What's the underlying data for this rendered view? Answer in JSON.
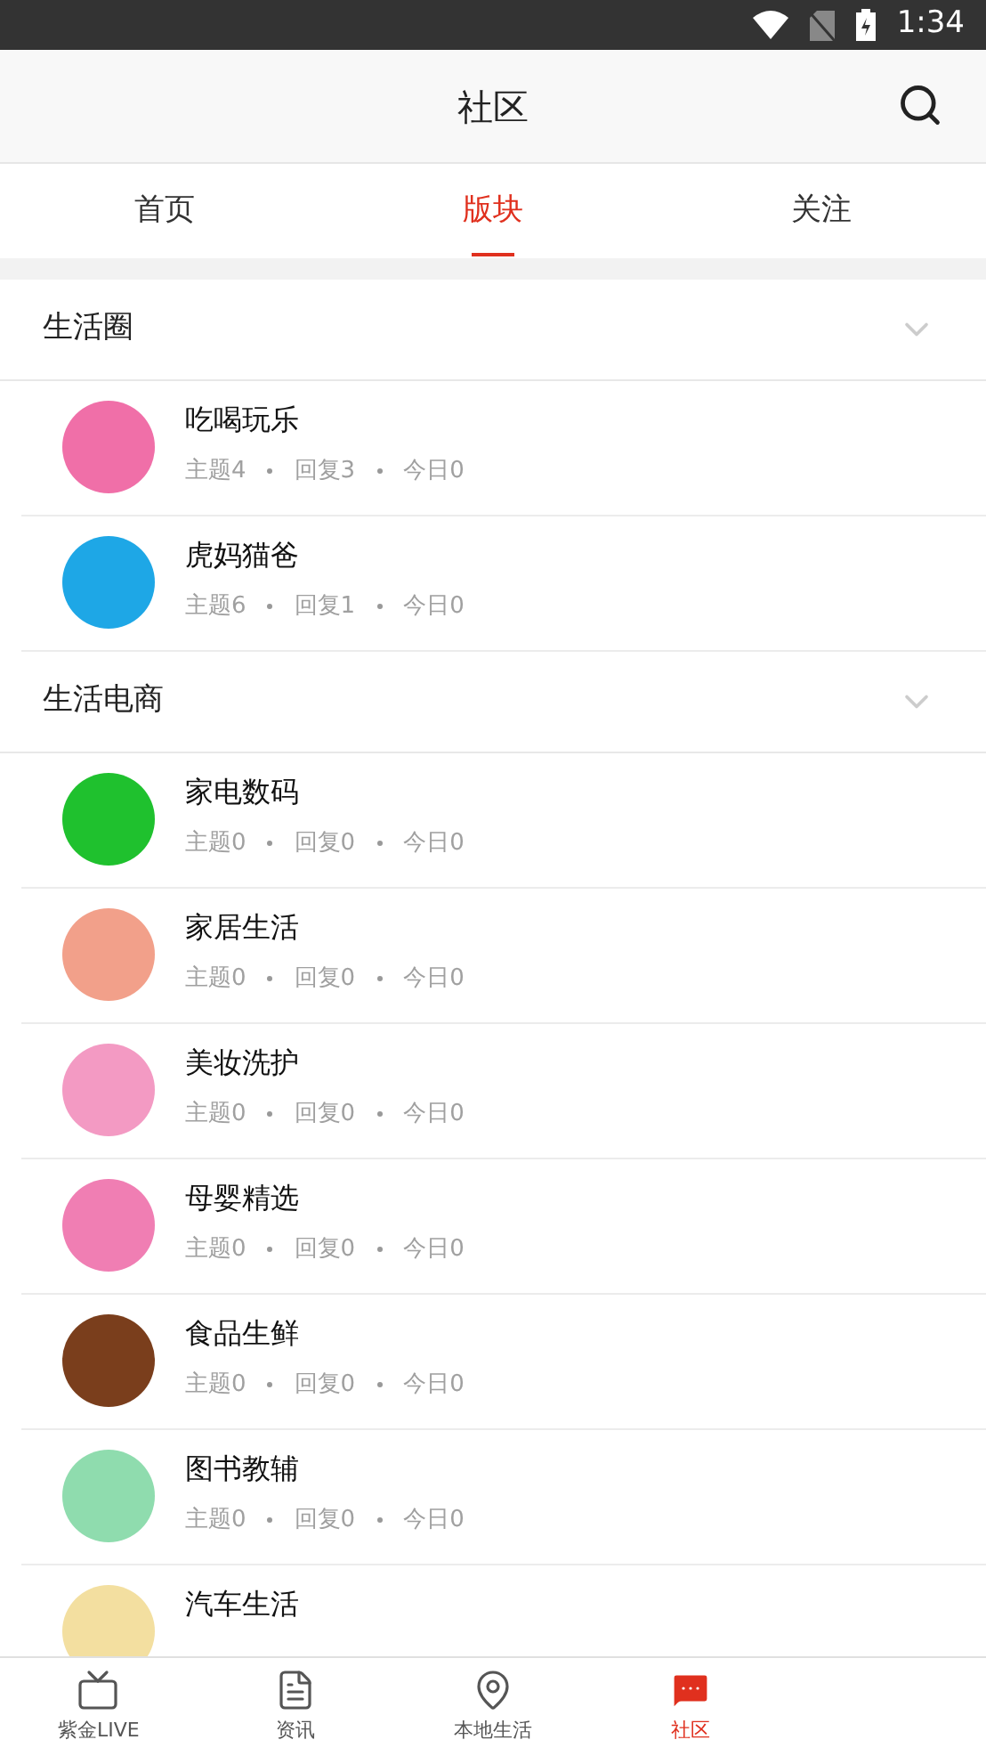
{
  "status_bar": {
    "time": "1:34"
  },
  "header": {
    "title": "社区"
  },
  "tabs": [
    {
      "label": "首页",
      "selected": false
    },
    {
      "label": "版块",
      "selected": true
    },
    {
      "label": "关注",
      "selected": false
    }
  ],
  "sections": [
    {
      "title": "生活圈",
      "expanded": true,
      "items": [
        {
          "name": "吃喝玩乐",
          "color": "#f06fa8",
          "stats": [
            "主题4",
            "回复3",
            "今日0"
          ]
        },
        {
          "name": "虎妈猫爸",
          "color": "#1ea7e6",
          "stats": [
            "主题6",
            "回复1",
            "今日0"
          ]
        }
      ]
    },
    {
      "title": "生活电商",
      "expanded": true,
      "items": [
        {
          "name": "家电数码",
          "color": "#1fc12e",
          "stats": [
            "主题0",
            "回复0",
            "今日0"
          ]
        },
        {
          "name": "家居生活",
          "color": "#f2a08a",
          "stats": [
            "主题0",
            "回复0",
            "今日0"
          ]
        },
        {
          "name": "美妆洗护",
          "color": "#f39ac3",
          "stats": [
            "主题0",
            "回复0",
            "今日0"
          ]
        },
        {
          "name": "母婴精选",
          "color": "#f07eb3",
          "stats": [
            "主题0",
            "回复0",
            "今日0"
          ]
        },
        {
          "name": "食品生鲜",
          "color": "#7a3e1c",
          "stats": [
            "主题0",
            "回复0",
            "今日0"
          ]
        },
        {
          "name": "图书教辅",
          "color": "#8fdcae",
          "stats": [
            "主题0",
            "回复0",
            "今日0"
          ]
        },
        {
          "name": "汽车生活",
          "color": "#f3dfa0"
        }
      ]
    }
  ],
  "bottom_nav": [
    {
      "label": "紫金LIVE",
      "kind": "tv",
      "selected": false
    },
    {
      "label": "资讯",
      "kind": "news",
      "selected": false
    },
    {
      "label": "本地生活",
      "kind": "pin",
      "selected": false
    },
    {
      "label": "社区",
      "kind": "chat",
      "selected": true
    }
  ]
}
